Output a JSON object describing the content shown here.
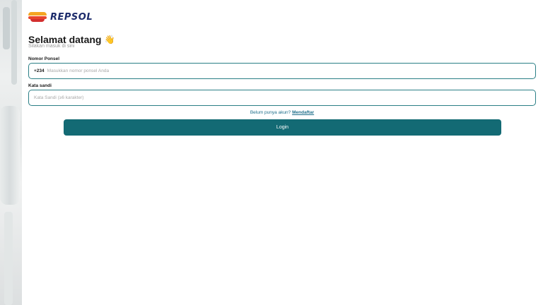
{
  "brand": {
    "name": "REPSOL"
  },
  "header": {
    "title": "Selamat datang",
    "wave_emoji": "👋",
    "subtitle": "Silakan masuk di sini"
  },
  "form": {
    "phone_label": "Nomor Ponsel",
    "phone_prefix": "+234",
    "phone_placeholder": "Masukkan nomor ponsel Anda",
    "phone_value": "",
    "password_label": "Kata sandi",
    "password_placeholder": "Kata Sandi (≥6 karakter)",
    "password_value": ""
  },
  "register": {
    "prompt": "Belum punya akun?",
    "link_label": "Mendaftar"
  },
  "login_button": {
    "label": "Login"
  },
  "colors": {
    "accent": "#136a74",
    "field_border": "#2a7f86",
    "link": "#1f6f8b",
    "brand_text": "#1c2b6b"
  }
}
